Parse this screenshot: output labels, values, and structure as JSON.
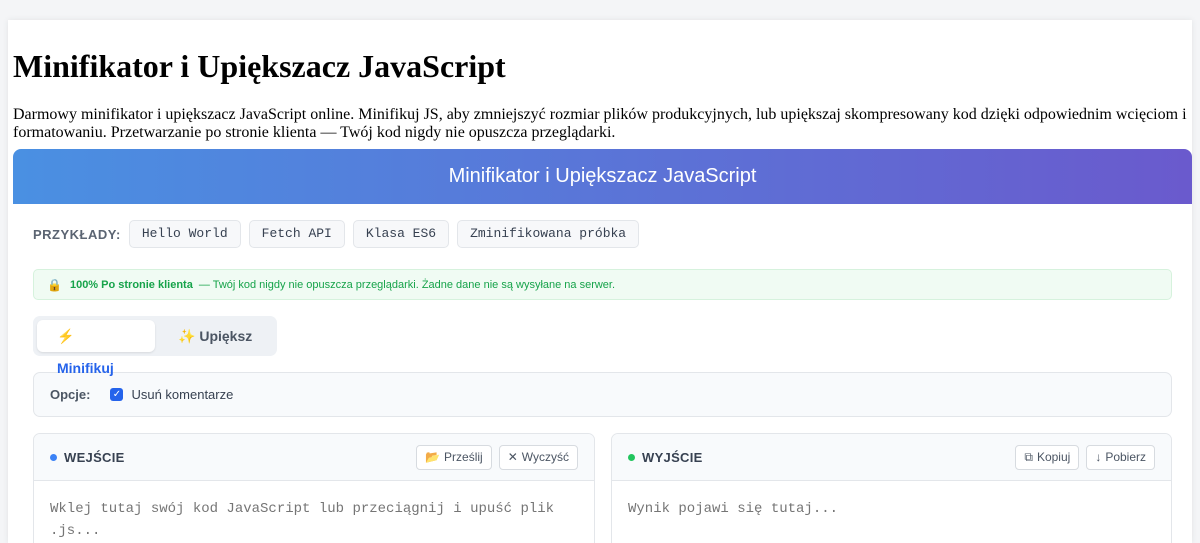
{
  "page": {
    "title": "Minifikator i Upiększacz JavaScript",
    "intro": "Darmowy minifikator i upiększacz JavaScript online. Minifikuj JS, aby zmniejszyć rozmiar plików produkcyjnych, lub upiększaj skompresowany kod dzięki odpowiednim wcięciom i formatowaniu. Przetwarzanie po stronie klienta — Twój kod nigdy nie opuszcza przeglądarki."
  },
  "tool": {
    "header_title": "Minifikator i Upiększacz JavaScript",
    "examples": {
      "label": "PRZYKŁADY:",
      "items": [
        "Hello World",
        "Fetch API",
        "Klasa ES6",
        "Zminifikowana próbka"
      ]
    },
    "privacy": {
      "icon": "lock-icon",
      "bold": "100% Po stronie klienta",
      "text": "— Twój kod nigdy nie opuszcza przeglądarki. Żadne dane nie są wysyłane na serwer."
    },
    "modes": [
      {
        "icon": "⚡",
        "label": "Minifikuj",
        "active": true
      },
      {
        "icon": "✨",
        "label": "Upiększ",
        "active": false
      }
    ],
    "options": {
      "label": "Opcje:",
      "remove_comments": {
        "label": "Usuń komentarze",
        "checked": true
      }
    },
    "input": {
      "title": "WEJŚCIE",
      "upload_label": "Prześlij",
      "clear_label": "Wyczyść",
      "placeholder": "Wklej tutaj swój kod JavaScript lub przeciągnij i upuść plik .js..."
    },
    "output": {
      "title": "WYJŚCIE",
      "copy_label": "Kopiuj",
      "download_label": "Pobierz",
      "placeholder": "Wynik pojawi się tutaj..."
    },
    "colors": {
      "accent": "#2563eb",
      "gradient_start": "#4a90e2",
      "gradient_end": "#6a5acd",
      "success": "#16a34a"
    }
  }
}
